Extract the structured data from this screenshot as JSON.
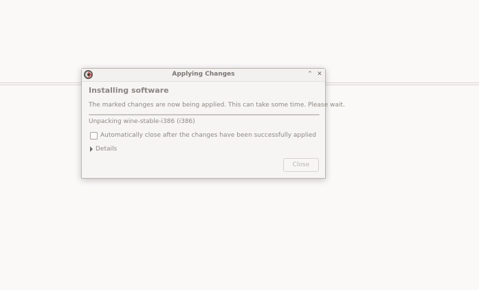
{
  "window": {
    "title": "Applying Changes",
    "app_icon": "package-manager-icon",
    "controls": {
      "maximize_glyph": "⌃",
      "close_glyph": "✕"
    }
  },
  "content": {
    "heading": "Installing software",
    "description": "The marked changes are now being applied. This can take some time. Please wait.",
    "progress_fraction": 1.0,
    "status": "Unpacking wine-stable-i386 (i386)",
    "auto_close_label": "Automatically close after the changes have been successfully applied",
    "auto_close_checked": false,
    "details_label": "Details",
    "close_button_label": "Close",
    "close_button_enabled": false
  }
}
